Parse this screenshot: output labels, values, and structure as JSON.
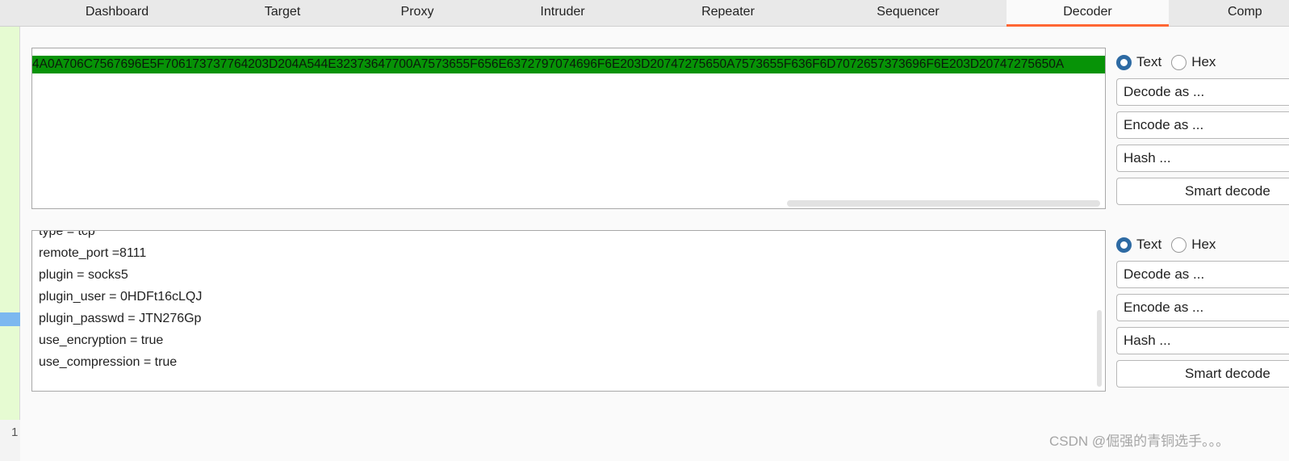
{
  "tabs": [
    {
      "label": "Dashboard",
      "active": false
    },
    {
      "label": "Target",
      "active": false
    },
    {
      "label": "Proxy",
      "active": false
    },
    {
      "label": "Intruder",
      "active": false
    },
    {
      "label": "Repeater",
      "active": false
    },
    {
      "label": "Sequencer",
      "active": false
    },
    {
      "label": "Decoder",
      "active": true
    },
    {
      "label": "Comp",
      "active": false
    }
  ],
  "left_gutter": {
    "line_number": "1"
  },
  "input_panel": {
    "hex_text": "4A0A706C7567696E5F706173737764203D204A544E32373647700A7573655F656E6372797074696F6E203D20747275650A7573655F636F6D7072657373696F6E203D20747275650A",
    "format": {
      "text_label": "Text",
      "hex_label": "Hex",
      "selected": "Text"
    },
    "decode_label": "Decode as ...",
    "encode_label": "Encode as ...",
    "hash_label": "Hash ...",
    "smart_label": "Smart decode"
  },
  "output_panel": {
    "lines": [
      "type = tcp",
      "remote_port =8111",
      "plugin = socks5",
      "plugin_user = 0HDFt16cLQJ",
      "plugin_passwd = JTN276Gp",
      "use_encryption = true",
      "use_compression = true"
    ],
    "format": {
      "text_label": "Text",
      "hex_label": "Hex",
      "selected": "Text"
    },
    "decode_label": "Decode as ...",
    "encode_label": "Encode as ...",
    "hash_label": "Hash ...",
    "smart_label": "Smart decode"
  },
  "watermark": "CSDN @倔强的青铜选手。。。",
  "colors": {
    "accent": "#ff6633",
    "selection": "#079307",
    "radio": "#2d6aa3"
  }
}
